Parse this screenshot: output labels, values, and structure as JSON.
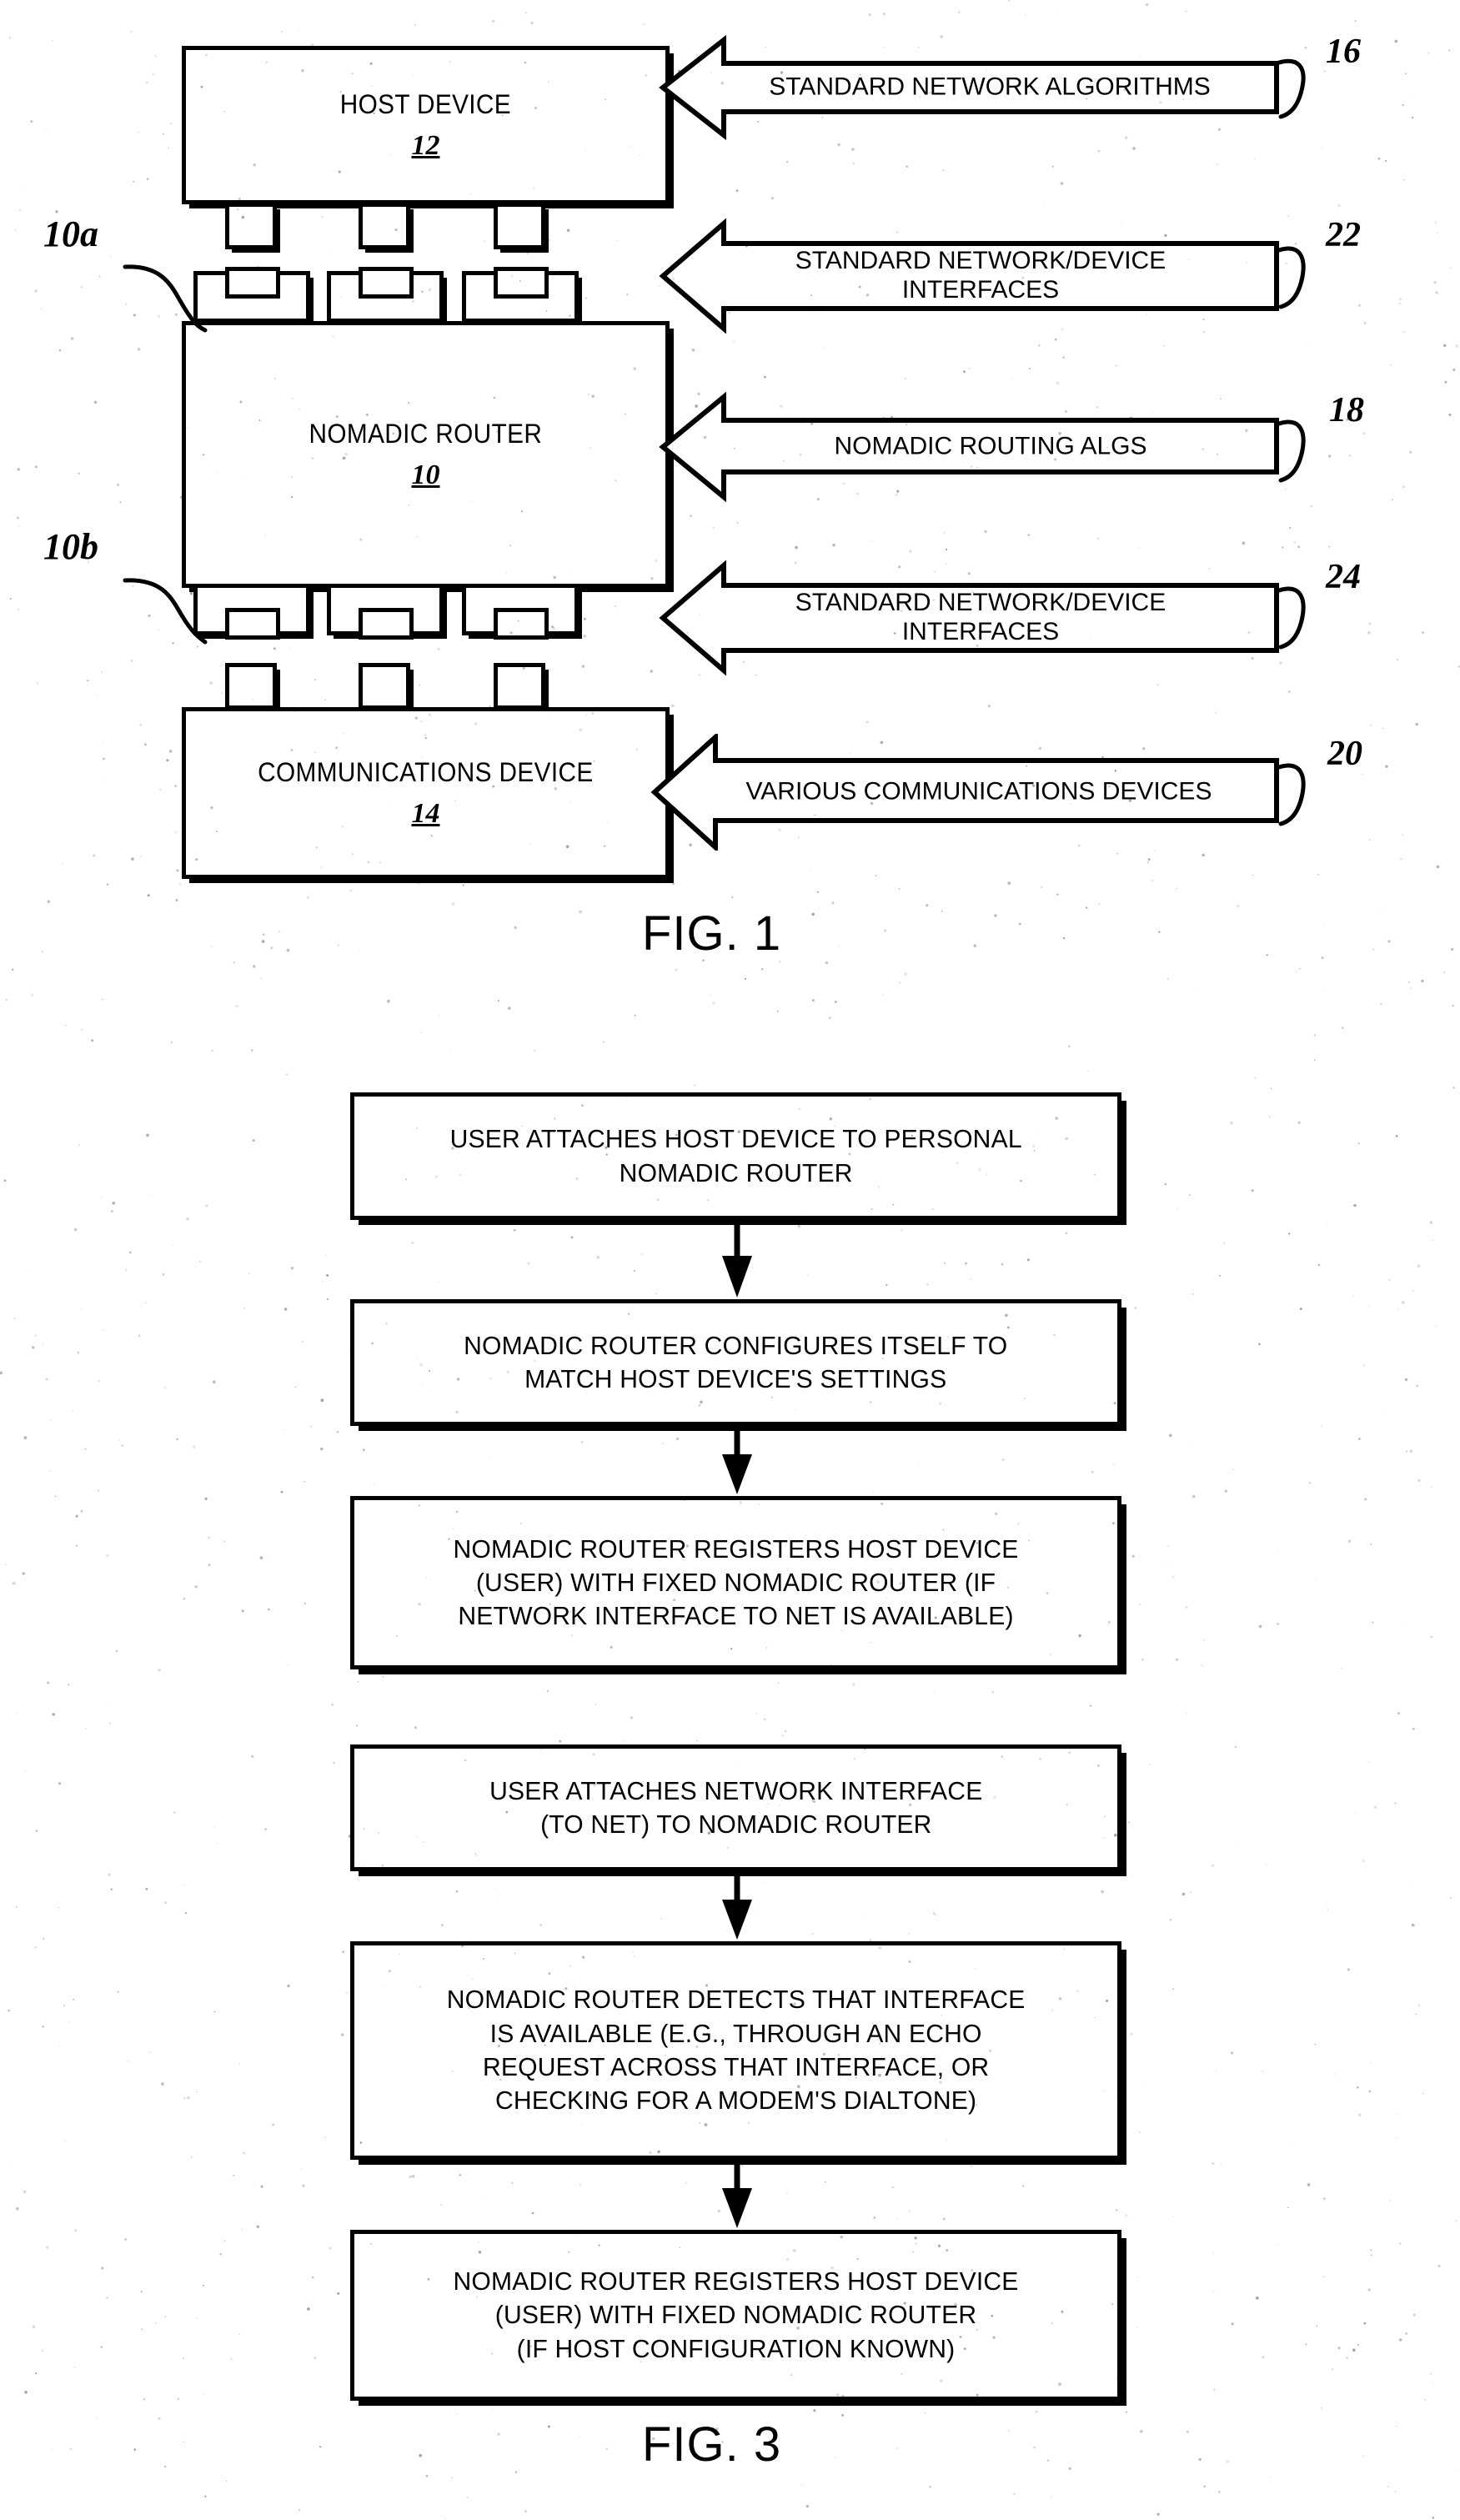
{
  "figure1": {
    "caption": "FIG. 1",
    "blocks": [
      {
        "title": "HOST DEVICE",
        "ref": "12"
      },
      {
        "title": "NOMADIC ROUTER",
        "ref": "10"
      },
      {
        "title": "COMMUNICATIONS DEVICE",
        "ref": "14"
      }
    ],
    "interface_refs": [
      {
        "label": "10a"
      },
      {
        "label": "10b"
      }
    ],
    "callouts": [
      {
        "text": "STANDARD NETWORK ALGORITHMS",
        "ref": "16"
      },
      {
        "text": "STANDARD NETWORK/DEVICE\nINTERFACES",
        "ref": "22"
      },
      {
        "text": "NOMADIC ROUTING ALGS",
        "ref": "18"
      },
      {
        "text": "STANDARD NETWORK/DEVICE\nINTERFACES",
        "ref": "24"
      },
      {
        "text": "VARIOUS COMMUNICATIONS DEVICES",
        "ref": "20"
      }
    ]
  },
  "figure3": {
    "caption": "FIG. 3",
    "steps": [
      {
        "text": "USER ATTACHES HOST DEVICE TO PERSONAL\nNOMADIC ROUTER"
      },
      {
        "text": "NOMADIC ROUTER CONFIGURES ITSELF TO\nMATCH HOST DEVICE'S SETTINGS"
      },
      {
        "text": "NOMADIC ROUTER REGISTERS HOST DEVICE\n(USER) WITH FIXED NOMADIC ROUTER (IF\nNETWORK INTERFACE TO NET IS AVAILABLE)"
      },
      {
        "text": "USER ATTACHES NETWORK INTERFACE\n(TO NET) TO NOMADIC ROUTER"
      },
      {
        "text": "NOMADIC ROUTER DETECTS THAT INTERFACE\nIS AVAILABLE (E.G., THROUGH AN ECHO\nREQUEST ACROSS THAT INTERFACE, OR\nCHECKING FOR A MODEM'S DIALTONE)"
      },
      {
        "text": "NOMADIC ROUTER REGISTERS HOST DEVICE\n(USER) WITH FIXED NOMADIC ROUTER\n(IF HOST CONFIGURATION KNOWN)"
      }
    ]
  },
  "colors": {
    "ink": "#000000",
    "paper": "#ffffff"
  }
}
